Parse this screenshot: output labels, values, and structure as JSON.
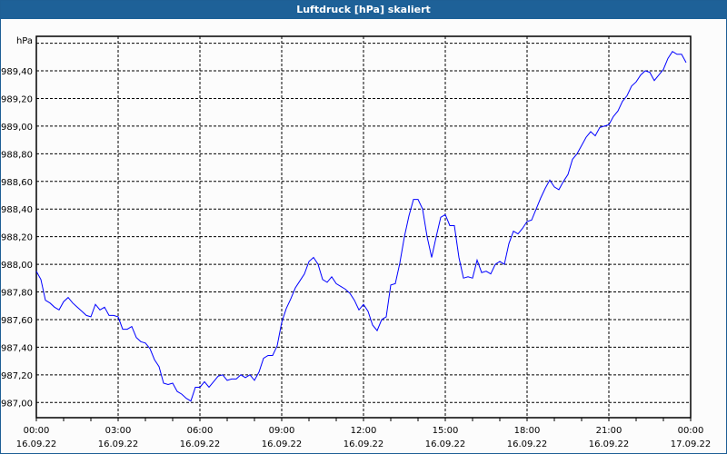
{
  "window": {
    "title": "Luftdruck [hPa] skaliert"
  },
  "chart_data": {
    "type": "line",
    "title": "Luftdruck [hPa] skaliert",
    "ylabel": "hPa",
    "xlabel": "",
    "ylim": [
      986.89,
      989.65
    ],
    "xlim_hours": [
      0,
      24
    ],
    "grid": true,
    "line_color": "#0000ff",
    "y_ticks": [
      {
        "value": 989.4,
        "label": "989,40"
      },
      {
        "value": 989.2,
        "label": "989,20"
      },
      {
        "value": 989.0,
        "label": "989,00"
      },
      {
        "value": 988.8,
        "label": "988,80"
      },
      {
        "value": 988.6,
        "label": "988,60"
      },
      {
        "value": 988.4,
        "label": "988,40"
      },
      {
        "value": 988.2,
        "label": "988,20"
      },
      {
        "value": 988.0,
        "label": "988,00"
      },
      {
        "value": 987.8,
        "label": "987,80"
      },
      {
        "value": 987.6,
        "label": "987,60"
      },
      {
        "value": 987.4,
        "label": "987,40"
      },
      {
        "value": 987.2,
        "label": "987,20"
      },
      {
        "value": 987.0,
        "label": "987,00"
      }
    ],
    "y_extra_gridline": 989.6,
    "x_ticks": [
      {
        "hour": 0,
        "time": "00:00",
        "date": "16.09.22"
      },
      {
        "hour": 3,
        "time": "03:00",
        "date": "16.09.22"
      },
      {
        "hour": 6,
        "time": "06:00",
        "date": "16.09.22"
      },
      {
        "hour": 9,
        "time": "09:00",
        "date": "16.09.22"
      },
      {
        "hour": 12,
        "time": "12:00",
        "date": "16.09.22"
      },
      {
        "hour": 15,
        "time": "15:00",
        "date": "16.09.22"
      },
      {
        "hour": 18,
        "time": "18:00",
        "date": "16.09.22"
      },
      {
        "hour": 21,
        "time": "21:00",
        "date": "16.09.22"
      },
      {
        "hour": 24,
        "time": "00:00",
        "date": "17.09.22"
      }
    ],
    "interval_minutes": 10,
    "values": [
      987.95,
      987.89,
      987.74,
      987.72,
      987.69,
      987.67,
      987.73,
      987.76,
      987.72,
      987.69,
      987.66,
      987.63,
      987.62,
      987.71,
      987.67,
      987.69,
      987.63,
      987.63,
      987.62,
      987.53,
      987.53,
      987.55,
      987.47,
      987.44,
      987.43,
      987.39,
      987.31,
      987.26,
      987.14,
      987.13,
      987.14,
      987.08,
      987.06,
      987.03,
      987.01,
      987.11,
      987.11,
      987.15,
      987.11,
      987.15,
      987.19,
      987.2,
      987.16,
      987.17,
      987.17,
      987.2,
      987.18,
      987.2,
      987.16,
      987.22,
      987.32,
      987.34,
      987.34,
      987.41,
      987.58,
      987.68,
      987.75,
      987.83,
      987.88,
      987.93,
      988.02,
      988.05,
      988.0,
      987.89,
      987.87,
      987.91,
      987.86,
      987.84,
      987.82,
      987.79,
      987.74,
      987.67,
      987.71,
      987.66,
      987.56,
      987.52,
      987.6,
      987.62,
      987.85,
      987.86,
      988.01,
      988.2,
      988.35,
      988.47,
      988.47,
      988.4,
      988.2,
      988.05,
      988.2,
      988.34,
      988.36,
      988.28,
      988.28,
      988.05,
      987.9,
      987.91,
      987.9,
      988.03,
      987.94,
      987.95,
      987.93,
      988.0,
      988.02,
      988.0,
      988.15,
      988.24,
      988.22,
      988.26,
      988.31,
      988.32,
      988.4,
      988.48,
      988.55,
      988.61,
      988.56,
      988.54,
      988.6,
      988.65,
      988.76,
      988.8,
      988.86,
      988.92,
      988.96,
      988.93,
      988.99,
      989.0,
      989.01,
      989.07,
      989.11,
      989.18,
      989.22,
      989.29,
      989.32,
      989.37,
      989.4,
      989.39,
      989.33,
      989.37,
      989.41,
      989.49,
      989.54,
      989.52,
      989.52,
      989.46
    ]
  }
}
